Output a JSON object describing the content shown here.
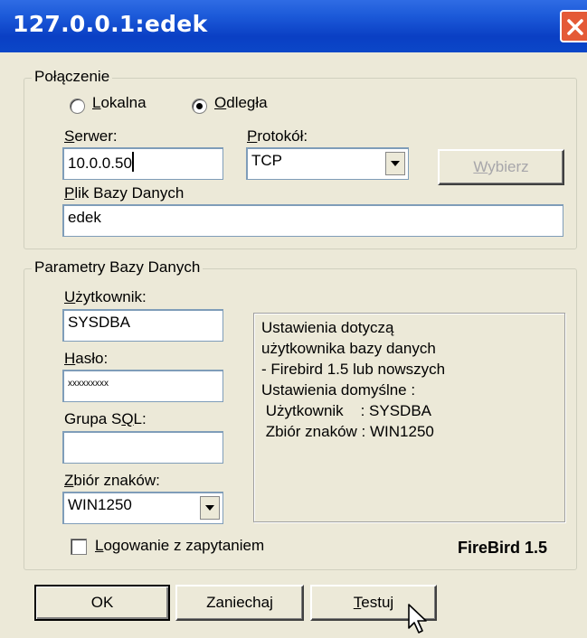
{
  "window": {
    "title": "127.0.0.1:edek"
  },
  "connection": {
    "legend": "Połączenie",
    "radio_local": {
      "pre": "",
      "key": "L",
      "post": "okalna",
      "selected": false
    },
    "radio_remote": {
      "pre": "",
      "key": "O",
      "post": "dległa",
      "selected": true
    },
    "server": {
      "label_key": "S",
      "label_rest": "erwer:",
      "value": "10.0.0.50"
    },
    "protocol": {
      "label_key": "P",
      "label_rest": "rotokół:",
      "value": "TCP"
    },
    "choose_button": {
      "key": "W",
      "rest": "ybierz",
      "enabled": false
    },
    "database_file": {
      "label_key": "P",
      "label_rest": "lik Bazy Danych",
      "value": "edek"
    }
  },
  "db_params": {
    "legend": "Parametry Bazy Danych",
    "user": {
      "label_key": "U",
      "label_rest": "żytkownik:",
      "value": "SYSDBA"
    },
    "password": {
      "label_key": "H",
      "label_rest": "asło:",
      "value": "xxxxxxxxx"
    },
    "sql_group": {
      "label_pre": "Grupa S",
      "label_key": "Q",
      "label_post": "L:",
      "value": ""
    },
    "charset": {
      "label_key": "Z",
      "label_rest": "biór znaków:",
      "value": "WIN1250"
    },
    "info_lines": [
      "Ustawienia dotyczą",
      "użytkownika bazy danych",
      "- Firebird 1.5 lub nowszych",
      "Ustawienia domyślne :",
      " Użytkownik    : SYSDBA",
      " Zbiór znaków : WIN1250"
    ],
    "login_prompt": {
      "pre": "",
      "key": "L",
      "post": "ogowanie z zapytaniem",
      "checked": false
    },
    "version_label": "FireBird 1.5"
  },
  "buttons": {
    "ok": "OK",
    "cancel": "Zaniechaj",
    "test_key": "T",
    "test_rest": "estuj"
  },
  "icons": {
    "close": "close-icon",
    "combo": "chevron-down-icon",
    "cursor": "mouse-pointer-icon"
  }
}
